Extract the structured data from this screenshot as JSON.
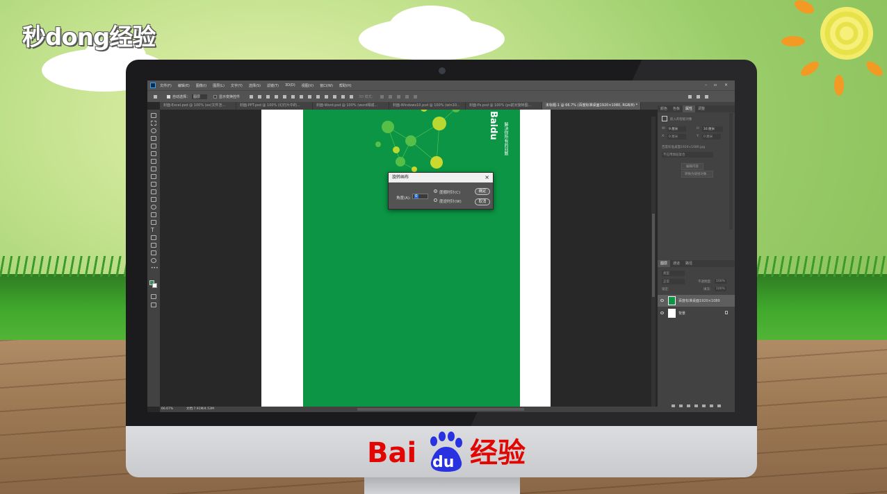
{
  "branding": {
    "top_logo": "秒dong经验",
    "bottom_logo_bai": "Bai",
    "bottom_logo_du": "du",
    "bottom_logo_jingyan": "经验"
  },
  "ps": {
    "menu": [
      "文件(F)",
      "编辑(E)",
      "图像(I)",
      "图层(L)",
      "文字(Y)",
      "选择(S)",
      "滤镜(T)",
      "3D(D)",
      "视图(V)",
      "窗口(W)",
      "帮助(H)"
    ],
    "options": {
      "auto_select": "自动选择：",
      "auto_select_value": "图层",
      "show_transform": "显示变换控件",
      "mode_3d": "3D 模式："
    },
    "tabs": [
      "封面-Excel.psd @ 100% (ex(文件怎...",
      "封面-PPT.psd @ 100% (幻灯片中的...",
      "封面-Word.psd @ 100% (word相成...",
      "封面-Windows10.psd @ 100% (win10...",
      "封面-Ps.psd @ 100% (ps前对旋转图...",
      "未标题-1 @ 66.7% (百度标准桌面1920×1080, RGB/8) *"
    ],
    "canvas_text": "解决你所有的问题",
    "canvas_logo": "Baidu",
    "status": {
      "zoom": "66.67%",
      "doc": "文档:7.91M/4.53M"
    },
    "properties_panel": {
      "tabs": [
        "颜色",
        "色板",
        "属性",
        "调整"
      ],
      "active_tab": "属性",
      "layer_type": "嵌入的智能对象",
      "w_label": "W:",
      "w_value": "9 厘米",
      "h_label": "H:",
      "h_value": "16 厘米",
      "x_label": "X:",
      "x_value": "0 厘米",
      "y_label": "Y:",
      "y_value": "0 厘米",
      "file": "百度标准桌面1920×1080.jpg",
      "layer_comp": "不应用图层复合",
      "btn_edit": "编辑内容",
      "btn_convert": "转换为链接对象..."
    },
    "layers_panel": {
      "tabs": [
        "图层",
        "通道",
        "路径"
      ],
      "search_placeholder": "类型",
      "blend_mode": "正常",
      "opacity_label": "不透明度:",
      "opacity_value": "100%",
      "lock_label": "锁定:",
      "fill_label": "填充:",
      "fill_value": "100%",
      "layers": [
        {
          "name": "百度标准桌面1920×1080",
          "selected": true
        },
        {
          "name": "背景",
          "selected": false,
          "locked": true
        }
      ]
    }
  },
  "dialog": {
    "title": "旋转画布",
    "angle_label": "角度(A):",
    "angle_value": "0",
    "radio_cw": "度顺时针(C)",
    "radio_ccw": "度逆时针(W)",
    "selected_radio": "度顺时针(C)",
    "ok": "确定",
    "cancel": "取消"
  },
  "colors": {
    "canvas_green": "#0b9544",
    "ps_dark": "#282828",
    "ps_panel": "#424242",
    "baidu_red": "#e10602",
    "baidu_blue": "#2932e1"
  }
}
